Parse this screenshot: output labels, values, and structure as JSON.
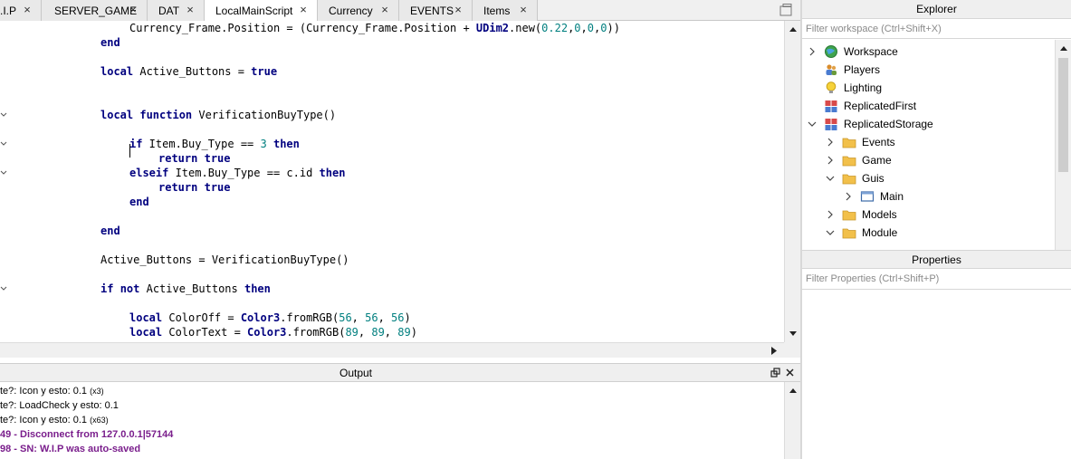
{
  "tabs": [
    {
      "label": ".I.P",
      "active": false
    },
    {
      "label": "SERVER_GAME",
      "active": false
    },
    {
      "label": "DAT",
      "active": false
    },
    {
      "label": "LocalMainScript",
      "active": true
    },
    {
      "label": "Currency",
      "active": false
    },
    {
      "label": "EVENTS",
      "active": false
    },
    {
      "label": "Items",
      "active": false
    }
  ],
  "tab_close_glyph": "×",
  "code_lines": [
    [
      {
        "t": "Currency_Frame.Position = (Currency_Frame.Position + ",
        "c": "id"
      },
      {
        "t": "UDim2",
        "c": "kw"
      },
      {
        "t": ".new(",
        "c": "id"
      },
      {
        "t": "0.22",
        "c": "num"
      },
      {
        "t": ",",
        "c": "id"
      },
      {
        "t": "0",
        "c": "num"
      },
      {
        "t": ",",
        "c": "id"
      },
      {
        "t": "0",
        "c": "num"
      },
      {
        "t": ",",
        "c": "id"
      },
      {
        "t": "0",
        "c": "num"
      },
      {
        "t": "))",
        "c": "id"
      }
    ],
    [
      {
        "t": "end",
        "c": "kw"
      }
    ],
    [],
    [
      {
        "t": "local",
        "c": "kw"
      },
      {
        "t": " Active_Buttons = ",
        "c": "id"
      },
      {
        "t": "true",
        "c": "kw"
      }
    ],
    [],
    [],
    [
      {
        "t": "local",
        "c": "kw"
      },
      {
        "t": " ",
        "c": "id"
      },
      {
        "t": "function",
        "c": "kw"
      },
      {
        "t": " VerificationBuyType()",
        "c": "id"
      }
    ],
    [],
    [
      {
        "t": "if",
        "c": "kw"
      },
      {
        "t": " Item.Buy_Type == ",
        "c": "id"
      },
      {
        "t": "3",
        "c": "num"
      },
      {
        "t": " ",
        "c": "id"
      },
      {
        "t": "then",
        "c": "kw"
      }
    ],
    [
      {
        "t": "return",
        "c": "kw"
      },
      {
        "t": " ",
        "c": "id"
      },
      {
        "t": "true",
        "c": "kw"
      }
    ],
    [
      {
        "t": "elseif",
        "c": "kw"
      },
      {
        "t": " Item.Buy_Type == c.id ",
        "c": "id"
      },
      {
        "t": "then",
        "c": "kw"
      }
    ],
    [
      {
        "t": "return",
        "c": "kw"
      },
      {
        "t": " ",
        "c": "id"
      },
      {
        "t": "true",
        "c": "kw"
      }
    ],
    [
      {
        "t": "end",
        "c": "kw"
      }
    ],
    [],
    [
      {
        "t": "end",
        "c": "kw"
      }
    ],
    [],
    [
      {
        "t": "Active_Buttons = VerificationBuyType()",
        "c": "id"
      }
    ],
    [],
    [
      {
        "t": "if",
        "c": "kw"
      },
      {
        "t": " ",
        "c": "id"
      },
      {
        "t": "not",
        "c": "kw"
      },
      {
        "t": " Active_Buttons ",
        "c": "id"
      },
      {
        "t": "then",
        "c": "kw"
      }
    ],
    [],
    [
      {
        "t": "local",
        "c": "kw"
      },
      {
        "t": " ColorOff = ",
        "c": "id"
      },
      {
        "t": "Color3",
        "c": "kw"
      },
      {
        "t": ".fromRGB(",
        "c": "id"
      },
      {
        "t": "56",
        "c": "num"
      },
      {
        "t": ", ",
        "c": "id"
      },
      {
        "t": "56",
        "c": "num"
      },
      {
        "t": ", ",
        "c": "id"
      },
      {
        "t": "56",
        "c": "num"
      },
      {
        "t": ")",
        "c": "id"
      }
    ],
    [
      {
        "t": "local",
        "c": "kw"
      },
      {
        "t": " ColorText = ",
        "c": "id"
      },
      {
        "t": "Color3",
        "c": "kw"
      },
      {
        "t": ".fromRGB(",
        "c": "id"
      },
      {
        "t": "89",
        "c": "num"
      },
      {
        "t": ", ",
        "c": "id"
      },
      {
        "t": "89",
        "c": "num"
      },
      {
        "t": ", ",
        "c": "id"
      },
      {
        "t": "89",
        "c": "num"
      },
      {
        "t": ")",
        "c": "id"
      }
    ]
  ],
  "output": {
    "title": "Output",
    "lines": [
      {
        "text": "te?: Icon y esto: 0.1",
        "count": "(x3)",
        "style": "normal"
      },
      {
        "text": "te?: LoadCheck y esto: 0.1",
        "count": "",
        "style": "normal"
      },
      {
        "text": "te?: Icon y esto: 0.1",
        "count": "(x63)",
        "style": "normal"
      },
      {
        "text": "49 - Disconnect from 127.0.0.1|57144",
        "count": "",
        "style": "purple"
      },
      {
        "text": "98 - SN: W.I.P was auto-saved",
        "count": "",
        "style": "purple"
      }
    ]
  },
  "explorer": {
    "title": "Explorer",
    "filter_placeholder": "Filter workspace (Ctrl+Shift+X)",
    "items": [
      {
        "label": "Workspace",
        "icon": "globe-icon"
      },
      {
        "label": "Players",
        "icon": "players-icon"
      },
      {
        "label": "Lighting",
        "icon": "lightbulb-icon"
      },
      {
        "label": "ReplicatedFirst",
        "icon": "replicated-icon"
      },
      {
        "label": "ReplicatedStorage",
        "icon": "replicated-icon"
      },
      {
        "label": "Events",
        "icon": "folder-icon"
      },
      {
        "label": "Game",
        "icon": "folder-icon"
      },
      {
        "label": "Guis",
        "icon": "folder-icon"
      },
      {
        "label": "Main",
        "icon": "screengui-icon"
      },
      {
        "label": "Models",
        "icon": "folder-icon"
      },
      {
        "label": "Module",
        "icon": "folder-icon"
      }
    ]
  },
  "properties": {
    "title": "Properties",
    "filter_placeholder": "Filter Properties (Ctrl+Shift+P)"
  },
  "colors": {
    "keyword": "#00007f",
    "number": "#007f7f",
    "output_purple": "#7a1e8c",
    "folder": "#f4c430"
  }
}
